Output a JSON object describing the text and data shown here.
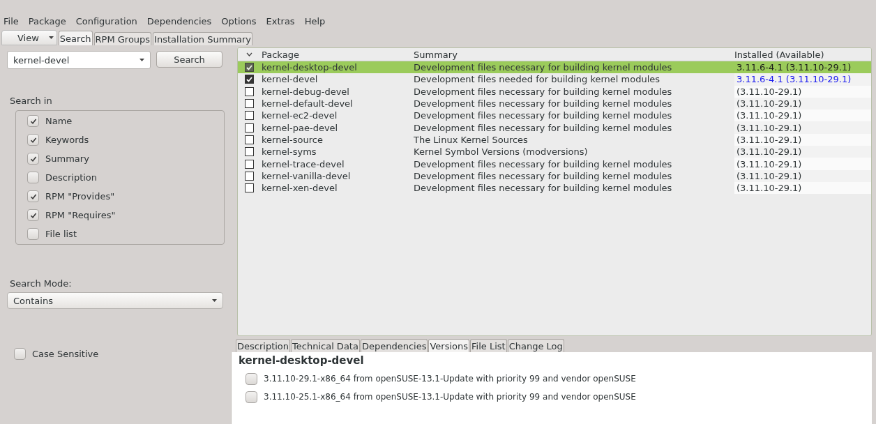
{
  "menu": [
    "File",
    "Package",
    "Configuration",
    "Dependencies",
    "Options",
    "Extras",
    "Help"
  ],
  "view_button": {
    "label": "View"
  },
  "tabs": [
    {
      "label": "Search",
      "selected": true
    },
    {
      "label": "RPM Groups",
      "selected": false
    },
    {
      "label": "Installation Summary",
      "selected": false
    }
  ],
  "search": {
    "value": "kernel-devel",
    "button": "Search"
  },
  "search_in": {
    "title": "Search in",
    "options": [
      {
        "label": "Name",
        "checked": true
      },
      {
        "label": "Keywords",
        "checked": true
      },
      {
        "label": "Summary",
        "checked": true
      },
      {
        "label": "Description",
        "checked": false
      },
      {
        "label": "RPM \"Provides\"",
        "checked": true
      },
      {
        "label": "RPM \"Requires\"",
        "checked": true
      },
      {
        "label": "File list",
        "checked": false
      }
    ]
  },
  "search_mode": {
    "label": "Search Mode:",
    "value": "Contains"
  },
  "case_sensitive": {
    "label": "Case Sensitive",
    "checked": false
  },
  "table": {
    "columns": [
      "Package",
      "Summary",
      "Installed (Available)"
    ],
    "rows": [
      {
        "checked": true,
        "selected": true,
        "kind": "installed",
        "package": "kernel-desktop-devel",
        "summary": "Development files necessary for building kernel modules",
        "installed": "3.11.6-4.1 (3.11.10-29.1)"
      },
      {
        "checked": true,
        "selected": false,
        "kind": "installed",
        "package": "kernel-devel",
        "summary": "Development files needed for building kernel modules",
        "installed": "3.11.6-4.1 (3.11.10-29.1)"
      },
      {
        "checked": false,
        "selected": false,
        "kind": "available",
        "package": "kernel-debug-devel",
        "summary": "Development files necessary for building kernel modules",
        "installed": "(3.11.10-29.1)"
      },
      {
        "checked": false,
        "selected": false,
        "kind": "available",
        "package": "kernel-default-devel",
        "summary": "Development files necessary for building kernel modules",
        "installed": "(3.11.10-29.1)"
      },
      {
        "checked": false,
        "selected": false,
        "kind": "available",
        "package": "kernel-ec2-devel",
        "summary": "Development files necessary for building kernel modules",
        "installed": "(3.11.10-29.1)"
      },
      {
        "checked": false,
        "selected": false,
        "kind": "available",
        "package": "kernel-pae-devel",
        "summary": "Development files necessary for building kernel modules",
        "installed": "(3.11.10-29.1)"
      },
      {
        "checked": false,
        "selected": false,
        "kind": "available",
        "package": "kernel-source",
        "summary": "The Linux Kernel Sources",
        "installed": "(3.11.10-29.1)"
      },
      {
        "checked": false,
        "selected": false,
        "kind": "available",
        "package": "kernel-syms",
        "summary": "Kernel Symbol Versions (modversions)",
        "installed": "(3.11.10-29.1)"
      },
      {
        "checked": false,
        "selected": false,
        "kind": "available",
        "package": "kernel-trace-devel",
        "summary": "Development files necessary for building kernel modules",
        "installed": "(3.11.10-29.1)"
      },
      {
        "checked": false,
        "selected": false,
        "kind": "available",
        "package": "kernel-vanilla-devel",
        "summary": "Development files necessary for building kernel modules",
        "installed": "(3.11.10-29.1)"
      },
      {
        "checked": false,
        "selected": false,
        "kind": "available",
        "package": "kernel-xen-devel",
        "summary": "Development files necessary for building kernel modules",
        "installed": "(3.11.10-29.1)"
      }
    ]
  },
  "detail_tabs": [
    {
      "label": "Description",
      "selected": false
    },
    {
      "label": "Technical Data",
      "selected": false
    },
    {
      "label": "Dependencies",
      "selected": false
    },
    {
      "label": "Versions",
      "selected": true
    },
    {
      "label": "File List",
      "selected": false
    },
    {
      "label": "Change Log",
      "selected": false
    }
  ],
  "details": {
    "title": "kernel-desktop-devel",
    "versions": [
      {
        "label": "3.11.10-29.1-x86_64 from openSUSE-13.1-Update with priority 99 and vendor openSUSE",
        "checked": false
      },
      {
        "label": "3.11.10-25.1-x86_64 from openSUSE-13.1-Update with priority 99 and vendor openSUSE",
        "checked": false
      }
    ]
  }
}
